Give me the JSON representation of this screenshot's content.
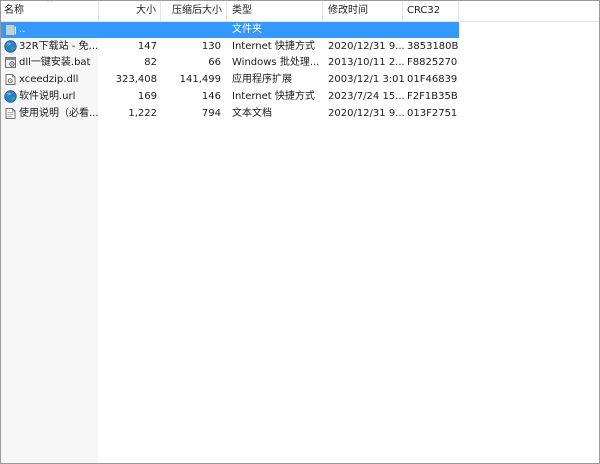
{
  "columns": {
    "name": "名称",
    "size": "大小",
    "packed": "压缩后大小",
    "type": "类型",
    "modified": "修改时间",
    "crc": "CRC32"
  },
  "sort_indicator": "^",
  "rows": [
    {
      "name": "..",
      "size": "",
      "packed": "",
      "type": "文件夹",
      "modified": "",
      "crc": "",
      "icon": "folder-up-icon"
    },
    {
      "name": "32R下载站 - 免...",
      "size": "147",
      "packed": "130",
      "type": "Internet 快捷方式",
      "modified": "2020/12/31 9...",
      "crc": "3853180B",
      "icon": "globe-icon"
    },
    {
      "name": "dll一键安装.bat",
      "size": "82",
      "packed": "66",
      "type": "Windows 批处理...",
      "modified": "2013/10/11 2...",
      "crc": "F8825270",
      "icon": "batch-file-icon"
    },
    {
      "name": "xceedzip.dll",
      "size": "323,408",
      "packed": "141,499",
      "type": "应用程序扩展",
      "modified": "2003/12/1 3:01",
      "crc": "01F46839",
      "icon": "dll-file-icon"
    },
    {
      "name": "软件说明.url",
      "size": "169",
      "packed": "146",
      "type": "Internet 快捷方式",
      "modified": "2023/7/24 15...",
      "crc": "F2F1B35B",
      "icon": "globe-icon"
    },
    {
      "name": "使用说明（必看...",
      "size": "1,222",
      "packed": "794",
      "type": "文本文档",
      "modified": "2020/12/31 9...",
      "crc": "013F2751",
      "icon": "text-file-icon"
    }
  ]
}
